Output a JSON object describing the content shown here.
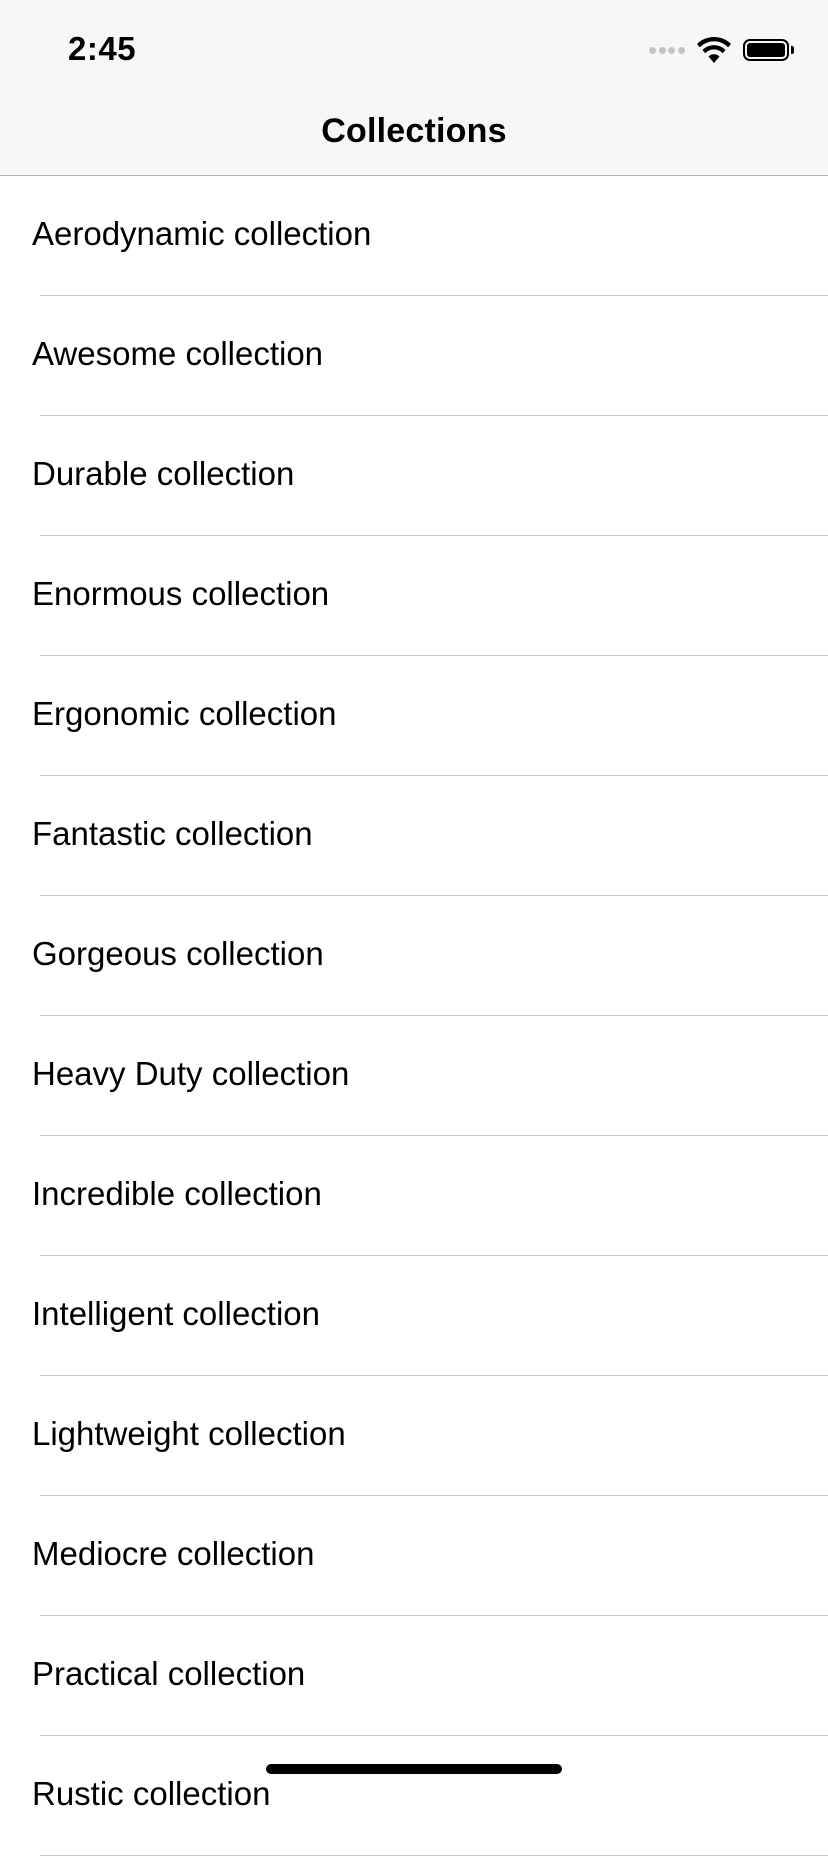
{
  "status_bar": {
    "time": "2:45",
    "icons": [
      "cellular-signal-icon",
      "wifi-icon",
      "battery-icon"
    ]
  },
  "nav_bar": {
    "title": "Collections"
  },
  "collections": [
    {
      "label": "Aerodynamic collection"
    },
    {
      "label": "Awesome collection"
    },
    {
      "label": "Durable collection"
    },
    {
      "label": "Enormous collection"
    },
    {
      "label": "Ergonomic collection"
    },
    {
      "label": "Fantastic collection"
    },
    {
      "label": "Gorgeous collection"
    },
    {
      "label": "Heavy Duty collection"
    },
    {
      "label": "Incredible collection"
    },
    {
      "label": "Intelligent collection"
    },
    {
      "label": "Lightweight collection"
    },
    {
      "label": "Mediocre collection"
    },
    {
      "label": "Practical collection"
    },
    {
      "label": "Rustic collection"
    }
  ],
  "colors": {
    "header_background": "#f7f7f7",
    "separator": "#c8c7cc",
    "text": "#000000"
  }
}
